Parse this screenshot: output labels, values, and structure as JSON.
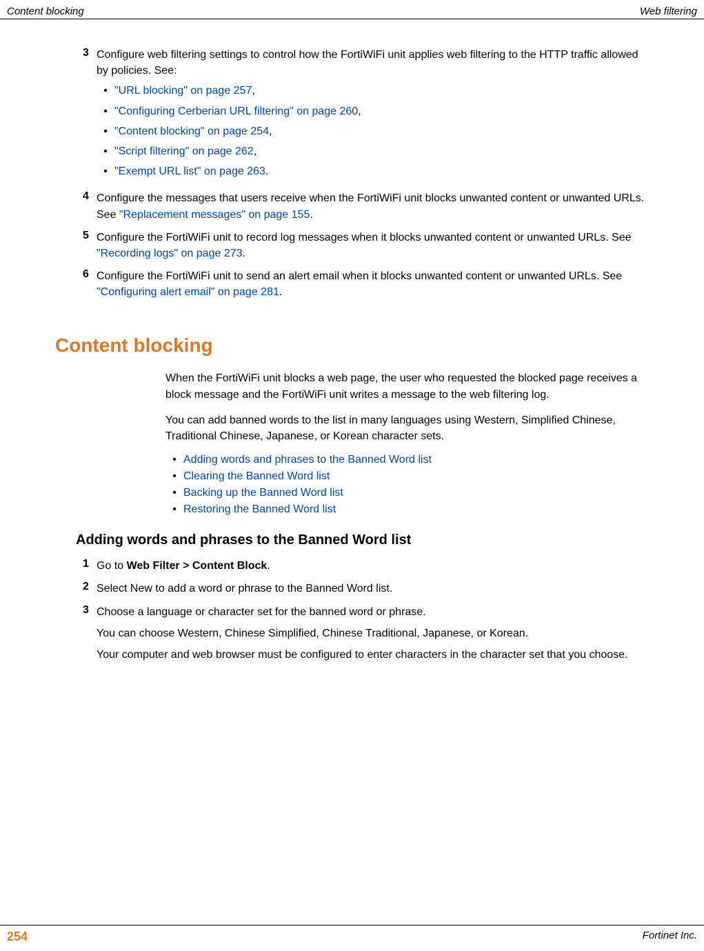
{
  "header": {
    "left": "Content blocking",
    "right": "Web filtering"
  },
  "steps_top": [
    {
      "num": "3",
      "text_before": "Configure web filtering settings to control how the FortiWiFi unit applies web filtering to the HTTP traffic allowed by policies. See:",
      "bullets": [
        {
          "link": "\"URL blocking\" on page 257",
          "suffix": ","
        },
        {
          "link": "\"Configuring Cerberian URL filtering\" on page 260",
          "suffix": ","
        },
        {
          "link": "\"Content blocking\" on page 254",
          "suffix": ","
        },
        {
          "link": "\"Script filtering\" on page 262",
          "suffix": ","
        },
        {
          "link": "\"Exempt URL list\" on page 263",
          "suffix": "."
        }
      ]
    },
    {
      "num": "4",
      "text_before": "Configure the messages that users receive when the FortiWiFi unit blocks unwanted content or unwanted URLs. See ",
      "link": "\"Replacement messages\" on page 155",
      "text_after": "."
    },
    {
      "num": "5",
      "text_before": "Configure the FortiWiFi unit to record log messages when it blocks unwanted content or unwanted URLs. See ",
      "link": "\"Recording logs\" on page 273",
      "text_after": "."
    },
    {
      "num": "6",
      "text_before": "Configure the FortiWiFi unit to send an alert email when it blocks unwanted content or unwanted URLs. See ",
      "link": "\"Configuring alert email\" on page 281",
      "text_after": "."
    }
  ],
  "section_heading": "Content blocking",
  "section_paras": [
    "When the FortiWiFi unit blocks a web page, the user who requested the blocked page receives a block message and the FortiWiFi unit writes a message to the web filtering log.",
    "You can add banned words to the list in many languages using Western, Simplified Chinese, Traditional Chinese, Japanese, or Korean character sets."
  ],
  "section_links": [
    "Adding words and phrases to the Banned Word list",
    "Clearing the Banned Word list",
    "Backing up the Banned Word list",
    "Restoring the Banned Word list"
  ],
  "subsection_heading": "Adding words and phrases to the Banned Word list",
  "subsection_steps": [
    {
      "num": "1",
      "prefix": "Go to ",
      "bold": "Web Filter > Content Block",
      "suffix": "."
    },
    {
      "num": "2",
      "text": "Select New to add a word or phrase to the Banned Word list."
    },
    {
      "num": "3",
      "text": "Choose a language or character set for the banned word or phrase.",
      "extra": [
        "You can choose Western, Chinese Simplified, Chinese Traditional, Japanese, or Korean.",
        "Your computer and web browser must be configured to enter characters in the character set that you choose."
      ]
    }
  ],
  "footer": {
    "page": "254",
    "right": "Fortinet Inc."
  }
}
